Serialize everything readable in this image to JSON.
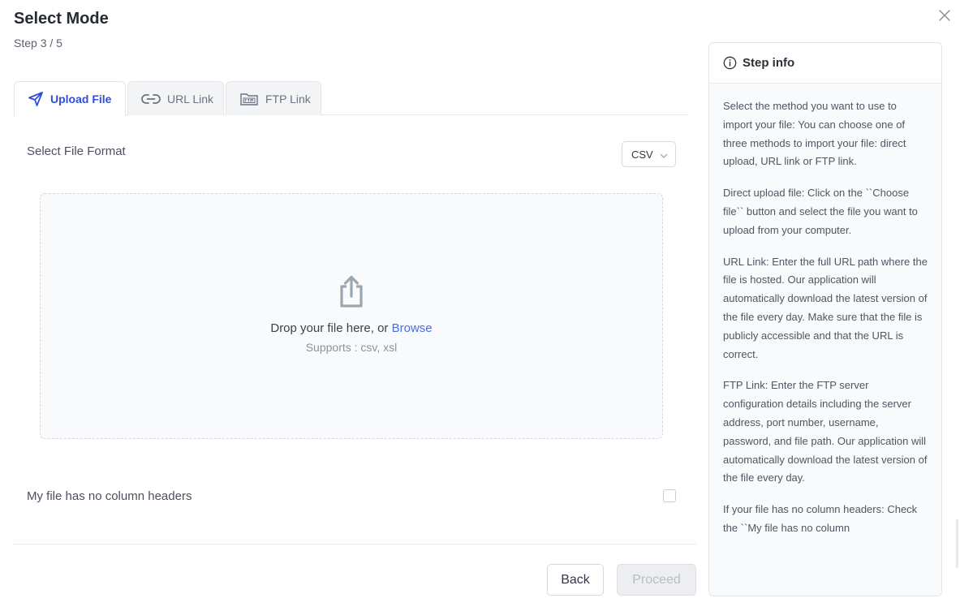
{
  "header": {
    "title": "Select Mode",
    "step": "Step 3 / 5"
  },
  "tabs": [
    {
      "label": "Upload File",
      "icon": "send-icon",
      "active": true
    },
    {
      "label": "URL Link",
      "icon": "link-icon",
      "active": false
    },
    {
      "label": "FTP Link",
      "icon": "ftp-folder-icon",
      "active": false
    }
  ],
  "format": {
    "label": "Select File Format",
    "selected": "CSV"
  },
  "dropzone": {
    "text": "Drop your file here, or",
    "browse": "Browse",
    "supports": "Supports : csv, xsl"
  },
  "options": {
    "no_headers_label": "My file has no column headers",
    "no_headers_checked": false
  },
  "footer": {
    "back_label": "Back",
    "proceed_label": "Proceed"
  },
  "info": {
    "title": "Step info",
    "paragraphs": [
      "Select the method you want to use to import your file: You can choose one of three methods to import your file: direct upload, URL link or FTP link.",
      "Direct upload file: Click on the ``Choose file`` button and select the file you want to upload from your computer.",
      "URL Link: Enter the full URL path where the file is hosted. Our application will automatically download the latest version of the file every day. Make sure that the file is publicly accessible and that the URL is correct.",
      "FTP Link: Enter the FTP server configuration details including the server address, port number, username, password, and file path. Our application will automatically download the latest version of the file every day.",
      "If your file has no column headers: Check the ``My file has no column"
    ]
  },
  "colors": {
    "accent": "#2f4fd6",
    "browse_link": "#4a6ee0"
  }
}
